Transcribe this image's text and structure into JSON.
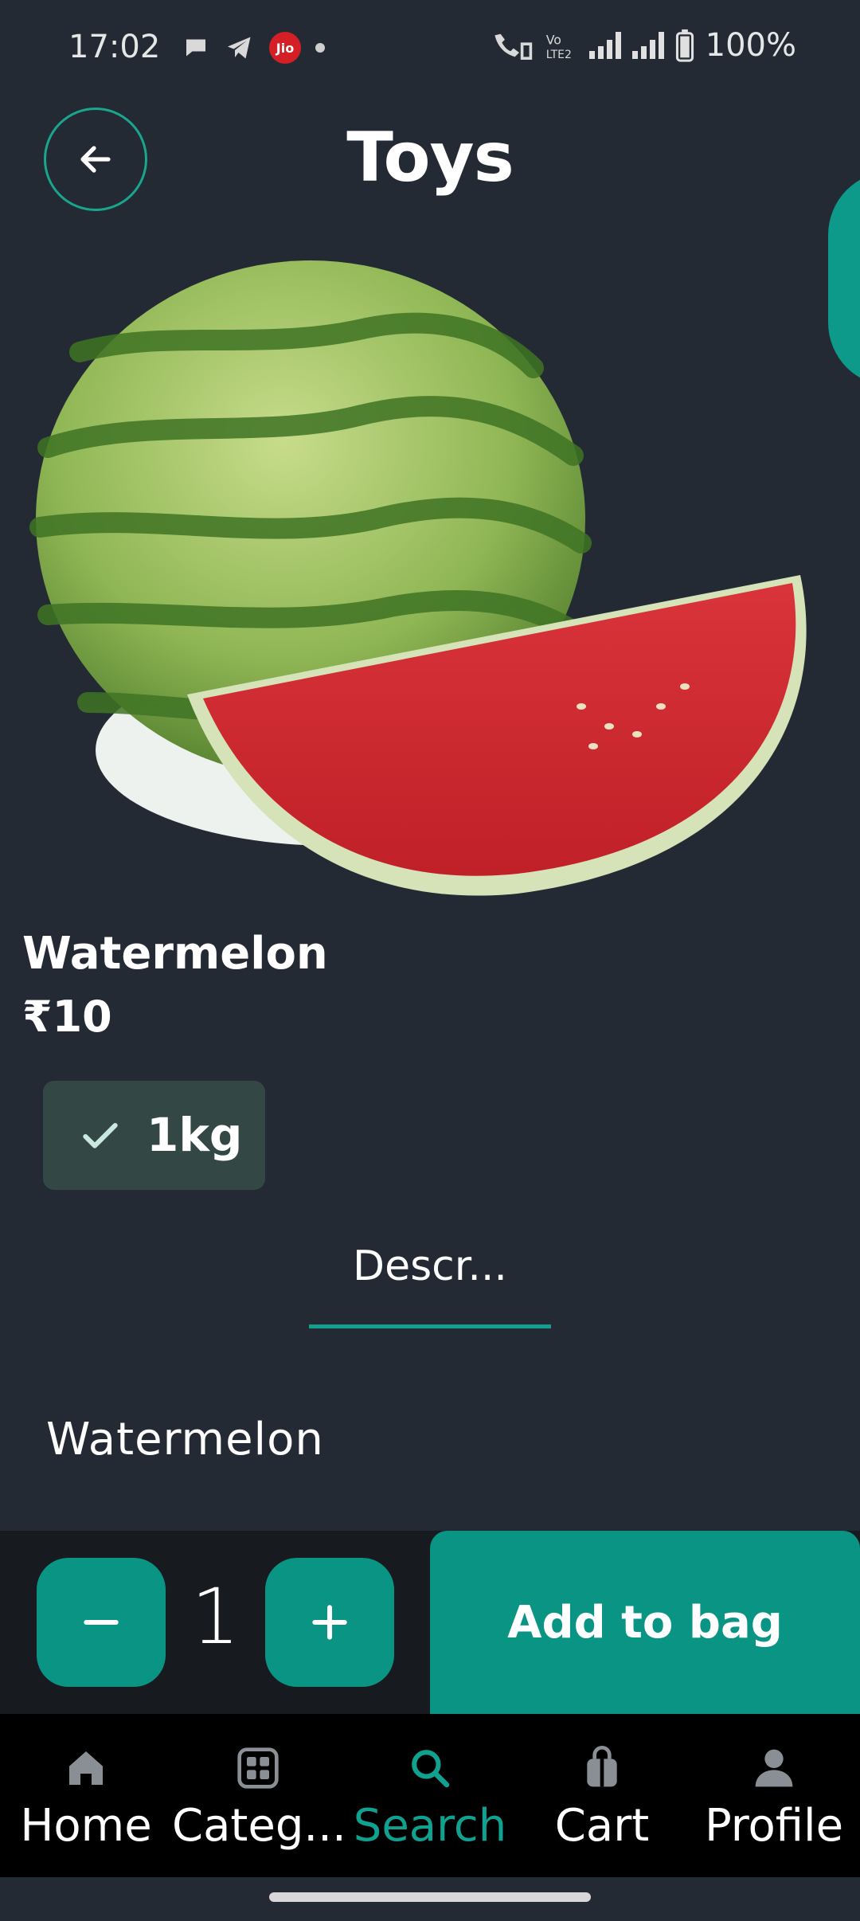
{
  "status_bar": {
    "time": "17:02",
    "battery": "100%",
    "operator_badge": "Jio",
    "icons": [
      "chat-icon",
      "telegram-icon",
      "jio-icon",
      "dot-icon",
      "wifi-call-icon",
      "volte-icon",
      "signal-icon",
      "signal-icon",
      "battery-icon"
    ]
  },
  "header": {
    "title": "Toys",
    "back_icon": "arrow-left-icon"
  },
  "product": {
    "name": "Watermelon",
    "price": "₹10",
    "image": "watermelon-photo"
  },
  "variant": {
    "label": "1kg",
    "selected": true,
    "icon": "check-icon"
  },
  "tabs": [
    {
      "label": "Descr...",
      "active": true
    }
  ],
  "description": "Watermelon",
  "quantity": {
    "value": "1",
    "minus_icon": "minus-icon",
    "plus_icon": "plus-icon"
  },
  "add_to_bag_label": "Add to bag",
  "bottom_nav": [
    {
      "label": "Home",
      "icon": "home-icon",
      "active": false
    },
    {
      "label": "Categ...",
      "icon": "categories-icon",
      "active": false
    },
    {
      "label": "Search",
      "icon": "search-icon",
      "active": true
    },
    {
      "label": "Cart",
      "icon": "cart-icon",
      "active": false
    },
    {
      "label": "Profile",
      "icon": "profile-icon",
      "active": false
    }
  ],
  "colors": {
    "background": "#242a34",
    "accent": "#099484",
    "chip": "#334744",
    "nav_background": "#000000"
  }
}
